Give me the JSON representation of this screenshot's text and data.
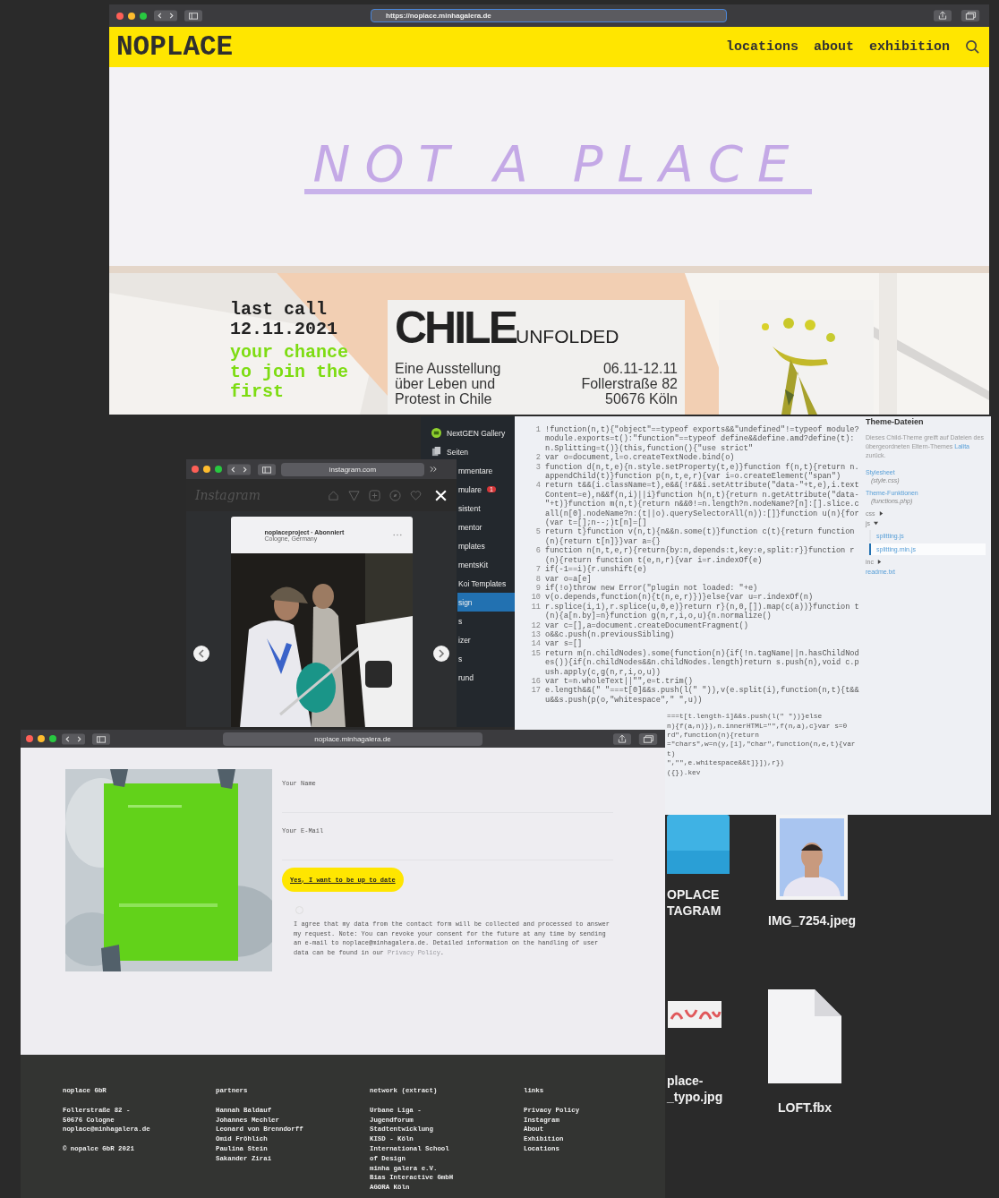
{
  "desktop": {
    "icons": [
      {
        "kind": "folder",
        "label_lines": [
          "OPLACE",
          "TAGRAM"
        ]
      },
      {
        "label_lines": [
          "IMG_7254.jpeg"
        ]
      },
      {
        "label_lines": [
          "place-",
          "_typo.jpg"
        ]
      },
      {
        "kind": "file",
        "label_lines": [
          "LOFT.fbx"
        ]
      }
    ]
  },
  "main_browser": {
    "url": "https://noplace.minhagalera.de",
    "logo": "NOPLACE",
    "nav": [
      "locations",
      "about",
      "exhibition"
    ],
    "hero_title": "NOT A PLACE",
    "banner": {
      "headline_lines": [
        "last call",
        "12.11.2021"
      ],
      "tagline_lines": [
        "your chance",
        "to join the",
        "first"
      ],
      "card": {
        "title": "CHILE",
        "subtitle": "UNFOLDED",
        "description_lines": [
          "Eine Ausstellung",
          "über Leben und",
          "Protest in Chile"
        ],
        "details_lines": [
          "06.11-12.11",
          "Follerstraße 82",
          "50676 Köln"
        ]
      }
    }
  },
  "admin_menu": {
    "items": [
      {
        "kind": "gallery",
        "label": "NextGEN Gallery",
        "selected": false
      },
      {
        "kind": "pages",
        "label": "Seiten",
        "selected": false
      },
      {
        "kind": "clipped",
        "label": "mmentare",
        "selected": false
      },
      {
        "kind": "clipped",
        "label": "mulare",
        "badge": "1",
        "selected": false
      },
      {
        "kind": "clipped",
        "label": "sistent",
        "selected": false
      },
      {
        "kind": "clipped",
        "label": "mentor",
        "selected": false
      },
      {
        "kind": "clipped",
        "label": "mplates",
        "selected": false
      },
      {
        "kind": "clipped",
        "label": "mentsKit",
        "selected": false
      },
      {
        "kind": "clipped",
        "label": "Koi Templates",
        "selected": false
      },
      {
        "kind": "clipped",
        "label": "sign",
        "selected": true
      },
      {
        "kind": "clipped",
        "label": "s",
        "selected": false
      },
      {
        "kind": "clipped",
        "label": "izer",
        "selected": false
      },
      {
        "kind": "clipped",
        "label": "s",
        "selected": false
      },
      {
        "kind": "clipped",
        "label": "rund",
        "selected": false
      }
    ]
  },
  "code_editor": {
    "lines": [
      {
        "number": "1",
        "text": "!function(n,t){\"object\"==typeof exports&&\"undefined\"!=typeof module?module.exports=t():\"function\"==typeof define&&define.amd?define(t):n.Splitting=t()}(this,function(){\"use strict\""
      },
      {
        "number": "2",
        "text": "var o=document,l=o.createTextNode.bind(o)"
      },
      {
        "number": "3",
        "text": "function d(n,t,e){n.style.setProperty(t,e)}function f(n,t){return n.appendChild(t)}function p(n,t,e,r){var i=o.createElement(\"span\")"
      },
      {
        "number": "4",
        "text": "return t&&(i.className=t),e&&(!r&&i.setAttribute(\"data-\"+t,e),i.textContent=e),n&&f(n,i)||i}function h(n,t){return n.getAttribute(\"data-\"+t)}function m(n,t){return n&&0!=n.length?n.nodeName?[n]:[].slice.call(n[0].nodeName?n:(t||o).querySelectorAll(n)):[]}function u(n){for(var t=[];n--;)t[n]=[]"
      },
      {
        "number": "5",
        "text": "return t}function v(n,t){n&&n.some(t)}function c(t){return function(n){return t[n]}}var a={}"
      },
      {
        "number": "6",
        "text": "function n(n,t,e,r){return{by:n,depends:t,key:e,split:r}}function r(n){return function t(e,n,r){var i=r.indexOf(e)"
      },
      {
        "number": "7",
        "text": "if(-1==i){r.unshift(e)"
      },
      {
        "number": "8",
        "text": "var o=a[e]"
      },
      {
        "number": "9",
        "text": "if(!o)throw new Error(\"plugin not loaded: \"+e)"
      },
      {
        "number": "10",
        "text": "v(o.depends,function(n){t(n,e,r)})}else{var u=r.indexOf(n)"
      },
      {
        "number": "11",
        "text": "r.splice(i,1),r.splice(u,0,e)}return r}(n,0,[]).map(c(a))}function t(n){a[n.by]=n}function g(n,r,i,o,u){n.normalize()"
      },
      {
        "number": "12",
        "text": "var c=[],a=document.createDocumentFragment()"
      },
      {
        "number": "13",
        "text": "o&&c.push(n.previousSibling)"
      },
      {
        "number": "14",
        "text": "var s=[]"
      },
      {
        "number": "15",
        "text": "return m(n.childNodes).some(function(n){if(!n.tagName||n.hasChildNodes()){if(n.childNodes&&n.childNodes.length)return s.push(n),void c.push.apply(c,g(n,r,i,o,u))"
      },
      {
        "number": "16",
        "text": "var t=n.wholeText||\"\",e=t.trim()"
      },
      {
        "number": "17",
        "text": "e.length&&(\" \"===t[0]&&s.push(l(\" \")),v(e.split(i),function(n,t){t&&u&&s.push(p(o,\"whitespace\",\" \",u))"
      }
    ],
    "overflow_fragments": [
      "===t[t.length-1]&&s.push(l(\" \"))}else",
      "n){f(a,n)}),n.innerHTML=\"\",f(n,a),c}var s=0",
      "rd\",function(n){return",
      "=\"chars\",w=n(y,[i],\"char\",function(n,e,t){var",
      "t)",
      "\",\"\",e.whitespace&&t]}]),r})",
      "({}).kev"
    ],
    "sidebar": {
      "heading": "Theme-Dateien",
      "description": "Dieses Child-Theme greift auf Dateien des übergeordneten Eltern-Themes",
      "description_link": "Lalita",
      "description_end": "zurück.",
      "tree": [
        {
          "kind": "file",
          "label": "Stylesheet",
          "sublabel": "(style.css)"
        },
        {
          "kind": "file",
          "label": "Theme-Funktionen",
          "sublabel": "(functions.php)"
        },
        {
          "kind": "folder",
          "label": "css",
          "expanded": false
        },
        {
          "kind": "folder",
          "label": "js",
          "expanded": true,
          "children": [
            {
              "kind": "file",
              "label": "splitting.js",
              "selected": false
            },
            {
              "kind": "file",
              "label": "splitting.min.js",
              "selected": true
            }
          ]
        },
        {
          "kind": "folder",
          "label": "inc",
          "expanded": false
        },
        {
          "kind": "file",
          "label": "readme.txt"
        }
      ]
    }
  },
  "instagram_window": {
    "url": "instagram.com",
    "logo": "Instagram",
    "post": {
      "header": "noplaceproject · Abonniert",
      "location": "Cologne, Germany"
    }
  },
  "form_window": {
    "url": "noplace.minhagalera.de",
    "fields": [
      {
        "label": "Your Name"
      },
      {
        "label": "Your E-Mail"
      }
    ],
    "submit": "Yes, I want to be up to date",
    "consent": {
      "checked": false,
      "text": "I agree that my data from the contact form will be collected and processed to answer my request. Note: You can revoke your consent for the future at any time by sending an e-mail to noplace@minhagalera.de. Detailed information on the handling of user data can be found in our",
      "link": "Privacy Policy",
      "end": "."
    },
    "footer": {
      "columns": [
        {
          "heading": "noplace GbR",
          "groups": [
            [
              "Follerstraße 82 -",
              "50676 Cologne",
              "noplace@minhagalera.de"
            ],
            [
              "© nopalce GbR 2021"
            ]
          ]
        },
        {
          "heading": "partners",
          "groups": [
            [
              "Hannah Baldauf",
              "Johannes Mechler",
              "Leonard von Brenndorff",
              "Omid Fröhlich",
              "Paulina Stein",
              "Sakander Zirai"
            ]
          ]
        },
        {
          "heading": "network (extract)",
          "groups": [
            [
              "Urbane Liga -",
              "Jugendforum",
              "Stadtentwicklung",
              "KISD - Köln",
              "International School",
              "of Design",
              "minha galera e.V.",
              "Bias Interactive GmbH",
              "AGORA Köln"
            ]
          ]
        },
        {
          "heading": "links",
          "groups": [
            [
              "Privacy Policy",
              "Instagram",
              "About",
              "Exhibition",
              "Locations"
            ]
          ]
        }
      ]
    }
  }
}
